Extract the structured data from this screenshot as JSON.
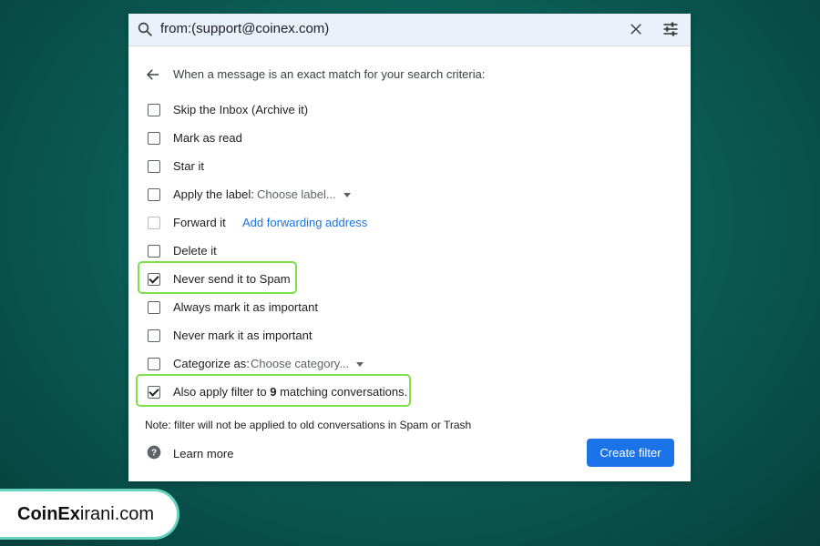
{
  "search": {
    "query": "from:(support@coinex.com)"
  },
  "filter": {
    "header": "When a message is an exact match for your search criteria:",
    "options": [
      {
        "label": "Skip the Inbox (Archive it)",
        "checked": false
      },
      {
        "label": "Mark as read",
        "checked": false
      },
      {
        "label": "Star it",
        "checked": false
      },
      {
        "label": "Apply the label:",
        "checked": false,
        "dropdown": "Choose label..."
      },
      {
        "label": "Forward it",
        "checked": false,
        "disabled": true,
        "link": "Add forwarding address"
      },
      {
        "label": "Delete it",
        "checked": false
      },
      {
        "label": "Never send it to Spam",
        "checked": true
      },
      {
        "label": "Always mark it as important",
        "checked": false
      },
      {
        "label": "Never mark it as important",
        "checked": false
      },
      {
        "label": "Categorize as:",
        "checked": false,
        "dropdown": "Choose category..."
      },
      {
        "label_pre": "Also apply filter to ",
        "count": "9",
        "label_post": " matching conversations.",
        "checked": true
      }
    ],
    "note": "Note: filter will not be applied to old conversations in Spam or Trash",
    "learn_more": "Learn more",
    "create_button": "Create filter"
  },
  "brand": {
    "bold": "CoinEx",
    "rest": "irani.com"
  },
  "colors": {
    "accent": "#1a73e8",
    "highlight": "#7ee04a",
    "background": "#0b5f57"
  }
}
